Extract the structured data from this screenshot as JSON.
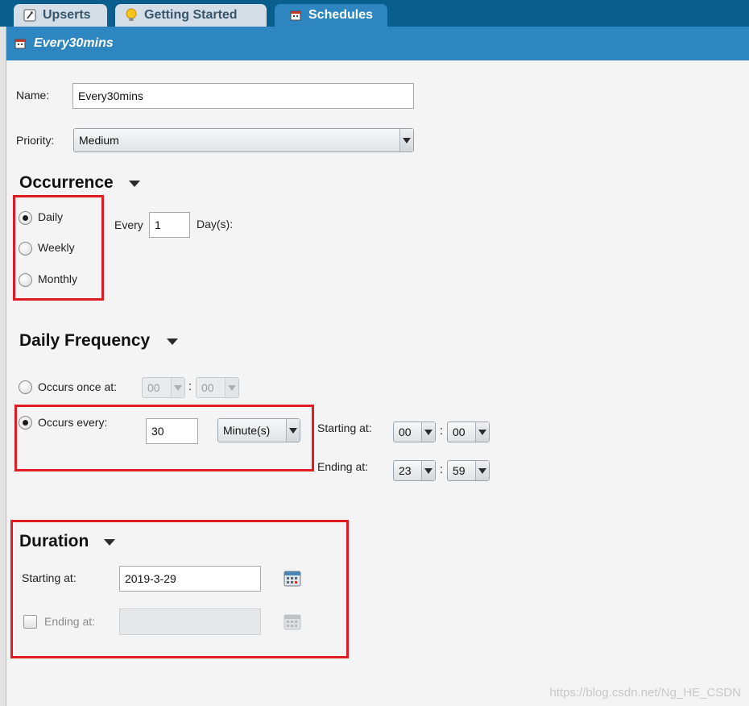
{
  "tabs": [
    {
      "label": "Upserts",
      "icon": "upsert-script-icon",
      "active": false
    },
    {
      "label": "Getting Started",
      "icon": "lightbulb-icon",
      "active": false
    },
    {
      "label": "Schedules",
      "icon": "calendar-icon",
      "active": true
    }
  ],
  "title": {
    "text": "Every30mins",
    "icon": "calendar-icon"
  },
  "form": {
    "name_label": "Name:",
    "name_value": "Every30mins",
    "priority_label": "Priority:",
    "priority_value": "Medium"
  },
  "occurrence": {
    "title": "Occurrence",
    "options": [
      "Daily",
      "Weekly",
      "Monthly"
    ],
    "selected": "Daily",
    "every_label": "Every",
    "every_value": "1",
    "unit_label": "Day(s):"
  },
  "daily_frequency": {
    "title": "Daily Frequency",
    "once_label": "Occurs once at:",
    "once_hour": "00",
    "once_minute": "00",
    "every_label": "Occurs every:",
    "every_value": "30",
    "every_unit": "Minute(s)",
    "starting_label": "Starting at:",
    "start_hour": "00",
    "start_minute": "00",
    "ending_label": "Ending at:",
    "end_hour": "23",
    "end_minute": "59",
    "selected": "Occurs every"
  },
  "duration": {
    "title": "Duration",
    "start_label": "Starting at:",
    "start_value": "2019-3-29",
    "end_label": "Ending at:",
    "end_value": "",
    "end_checked": false
  },
  "colors": {
    "tab_bar": "#0a5e8e",
    "active_tab": "#2d86bf",
    "highlight_box": "#e11b22"
  },
  "watermark": "https://blog.csdn.net/Ng_HE_CSDN"
}
